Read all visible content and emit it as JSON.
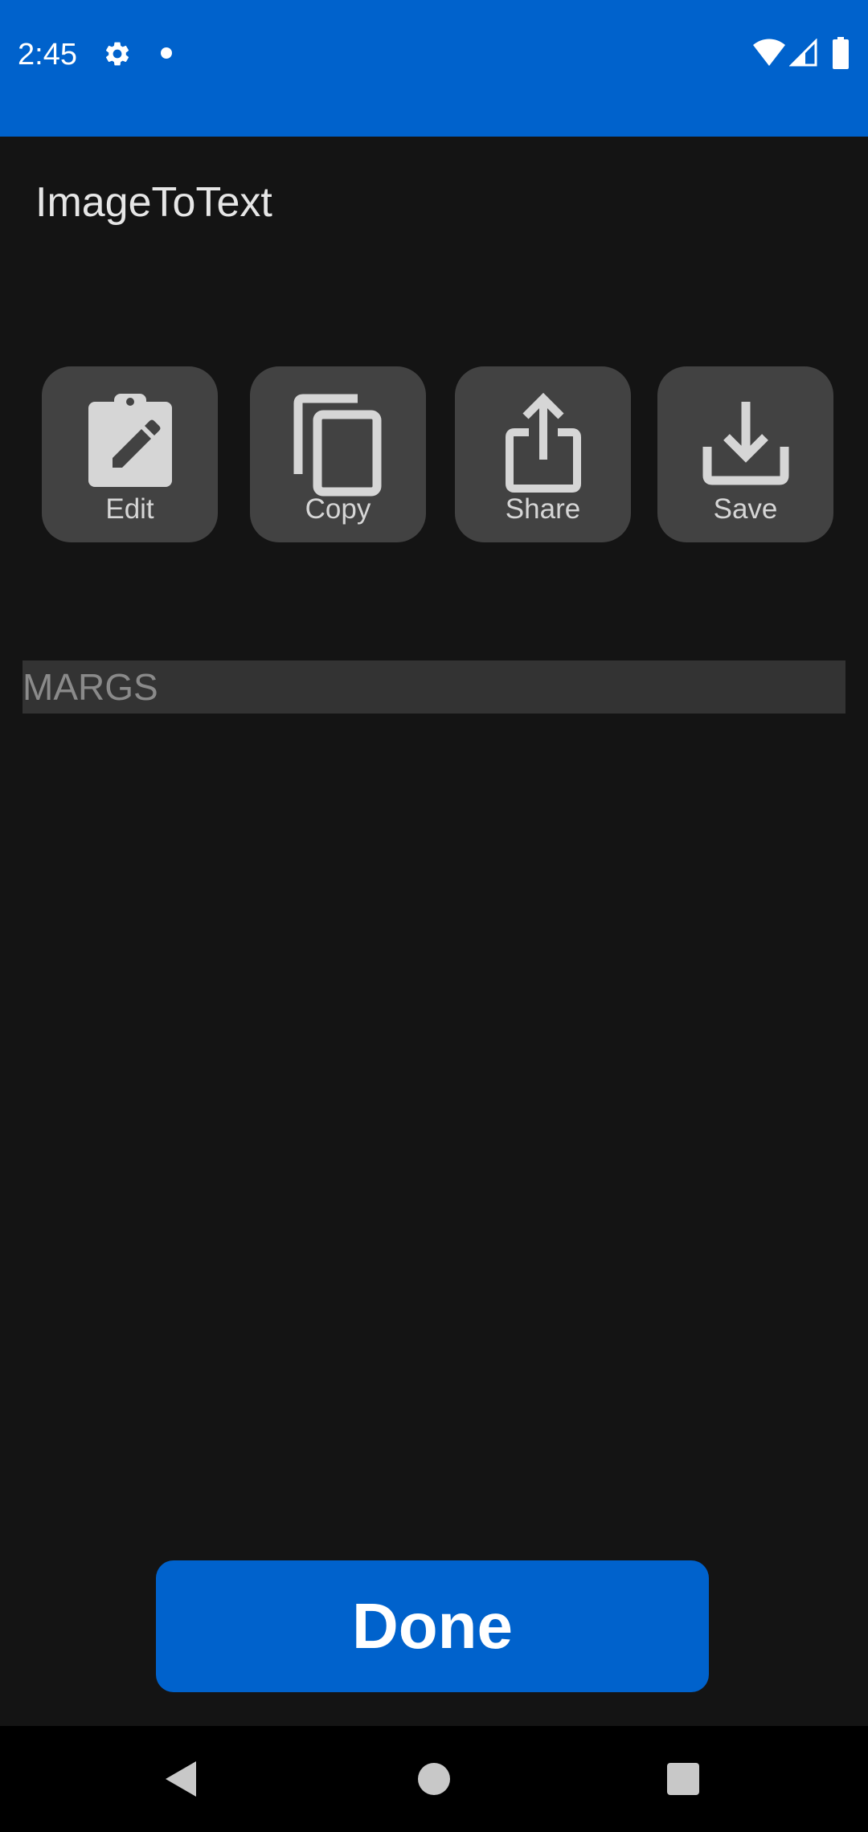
{
  "status_bar": {
    "time": "2:45",
    "background_color": "#0062cc",
    "icons": [
      "gear-icon",
      "notification-dot-icon",
      "wifi-icon",
      "signal-icon",
      "battery-icon"
    ]
  },
  "app": {
    "title": "ImageToText"
  },
  "actions": [
    {
      "label": "Edit",
      "icon": "edit-clipboard-icon"
    },
    {
      "label": "Copy",
      "icon": "copy-icon"
    },
    {
      "label": "Share",
      "icon": "share-icon"
    },
    {
      "label": "Save",
      "icon": "save-download-icon"
    }
  ],
  "text_field": {
    "value": "MARGS"
  },
  "done_button": {
    "label": "Done",
    "color": "#0062cc"
  },
  "nav_bar": {
    "icons": [
      "back-icon",
      "home-icon",
      "recents-icon"
    ]
  }
}
